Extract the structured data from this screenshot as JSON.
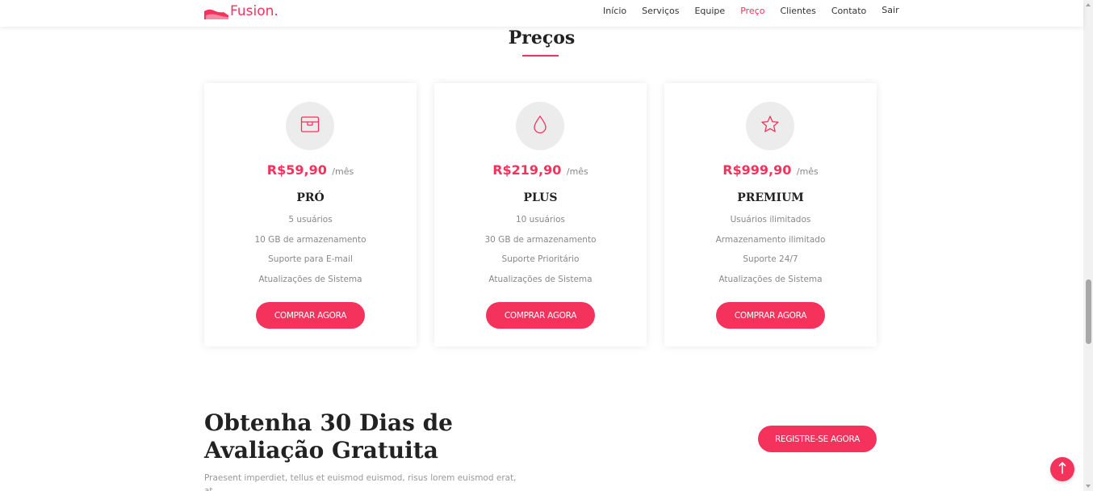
{
  "brand": {
    "name": "Fusion.",
    "color": "#f5325c"
  },
  "nav": [
    {
      "label": "Início",
      "active": false
    },
    {
      "label": "Serviços",
      "active": false
    },
    {
      "label": "Equipe",
      "active": false
    },
    {
      "label": "Preço",
      "active": true
    },
    {
      "label": "Clientes",
      "active": false
    },
    {
      "label": "Contato",
      "active": false
    },
    {
      "label": "Sair",
      "active": false
    }
  ],
  "pricing": {
    "title": "Preços",
    "plans": [
      {
        "icon": "box-icon",
        "price": "R$59,90",
        "period": "/mês",
        "name": "PRÓ",
        "features": [
          "5 usuários",
          "10 GB de armazenamento",
          "Suporte para E-mail",
          "Atualizações de Sistema"
        ],
        "button": "COMPRAR AGORA"
      },
      {
        "icon": "droplet-icon",
        "price": "R$219,90",
        "period": "/mês",
        "name": "PLUS",
        "features": [
          "10 usuários",
          "30 GB de armazenamento",
          "Suporte Prioritário",
          "Atualizações de Sistema"
        ],
        "button": "COMPRAR AGORA"
      },
      {
        "icon": "star-icon",
        "price": "R$999,90",
        "period": "/mês",
        "name": "PREMIUM",
        "features": [
          "Usuários ilimitados",
          "Armazenamento ilimitado",
          "Suporte 24/7",
          "Atualizações de Sistema"
        ],
        "button": "COMPRAR AGORA"
      }
    ]
  },
  "cta": {
    "title": "Obtenha 30 Dias de Avaliação Gratuita",
    "text": "Praesent imperdiet, tellus et euismod euismod, risus lorem euismod erat, at",
    "button": "REGISTRE-SE AGORA"
  },
  "back_to_top_icon": "arrow-up-icon"
}
